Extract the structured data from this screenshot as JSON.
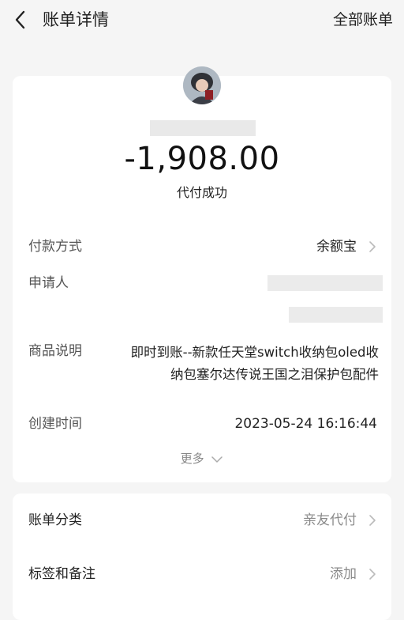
{
  "header": {
    "title": "账单详情",
    "right_link": "全部账单"
  },
  "summary": {
    "amount": "-1,908.00",
    "status": "代付成功"
  },
  "details": {
    "payment_method": {
      "label": "付款方式",
      "value": "余额宝"
    },
    "applicant": {
      "label": "申请人"
    },
    "description": {
      "label": "商品说明",
      "value_line1": "即时到账--新款任天堂switch收纳包oled收",
      "value_line2": "纳包塞尔达传说王国之泪保护包配件"
    },
    "created_time": {
      "label": "创建时间",
      "value": "2023-05-24 16:16:44"
    },
    "more": "更多"
  },
  "extra": {
    "category": {
      "label": "账单分类",
      "value": "亲友代付"
    },
    "tags": {
      "label": "标签和备注",
      "value": "添加"
    }
  },
  "icons": [
    "back-chevron-icon",
    "chevron-right-icon",
    "chevron-down-icon"
  ],
  "colors": {
    "background": "#f5f5f5",
    "card": "#ffffff",
    "muted": "#8a8a8a"
  }
}
